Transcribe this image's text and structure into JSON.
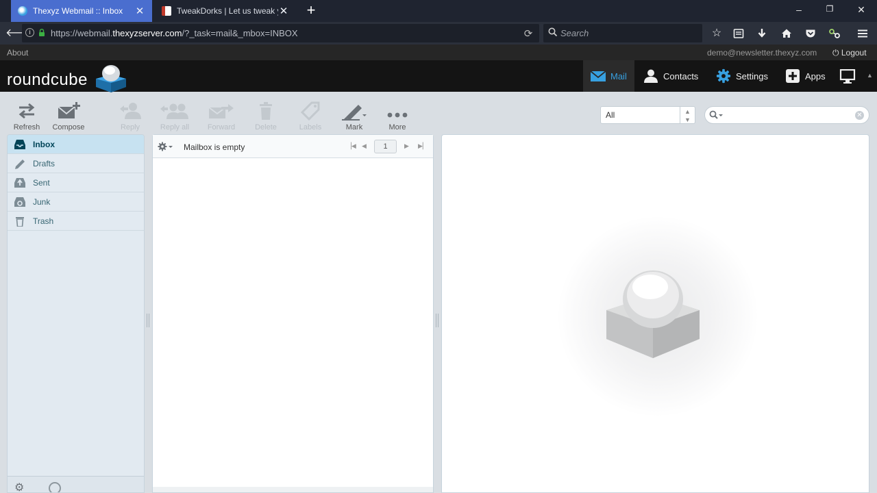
{
  "browser": {
    "tabs": [
      {
        "title": "Thexyz Webmail :: Inbox",
        "active": true
      },
      {
        "title": "TweakDorks | Let us tweak y",
        "active": false
      }
    ],
    "url_prefix": "https://webmail.",
    "url_domain": "thexyzserver.com",
    "url_path": "/?_task=mail&_mbox=INBOX",
    "search_placeholder": "Search"
  },
  "topline": {
    "about": "About",
    "username": "demo@newsletter.thexyz.com",
    "logout": "Logout"
  },
  "header": {
    "logo_text": "roundcube",
    "tasks": [
      {
        "label": "Mail",
        "icon": "envelope-icon",
        "selected": true
      },
      {
        "label": "Contacts",
        "icon": "person-icon",
        "selected": false
      },
      {
        "label": "Settings",
        "icon": "gear-icon",
        "selected": false
      },
      {
        "label": "Apps",
        "icon": "plus-icon",
        "selected": false
      }
    ]
  },
  "toolbar": {
    "refresh": "Refresh",
    "compose": "Compose",
    "reply": "Reply",
    "reply_all": "Reply all",
    "forward": "Forward",
    "delete": "Delete",
    "labels": "Labels",
    "mark": "Mark",
    "more": "More",
    "filter_value": "All"
  },
  "folders": [
    {
      "label": "Inbox",
      "icon": "inbox-icon",
      "selected": true
    },
    {
      "label": "Drafts",
      "icon": "pencil-icon",
      "selected": false
    },
    {
      "label": "Sent",
      "icon": "sent-icon",
      "selected": false
    },
    {
      "label": "Junk",
      "icon": "junk-icon",
      "selected": false
    },
    {
      "label": "Trash",
      "icon": "trash-icon",
      "selected": false
    }
  ],
  "messagelist": {
    "status": "Mailbox is empty",
    "page": "1"
  },
  "colors": {
    "active_tab": "#4a6ecf",
    "mail_accent": "#37a0e0",
    "selected_folder": "#c7e2f1"
  }
}
